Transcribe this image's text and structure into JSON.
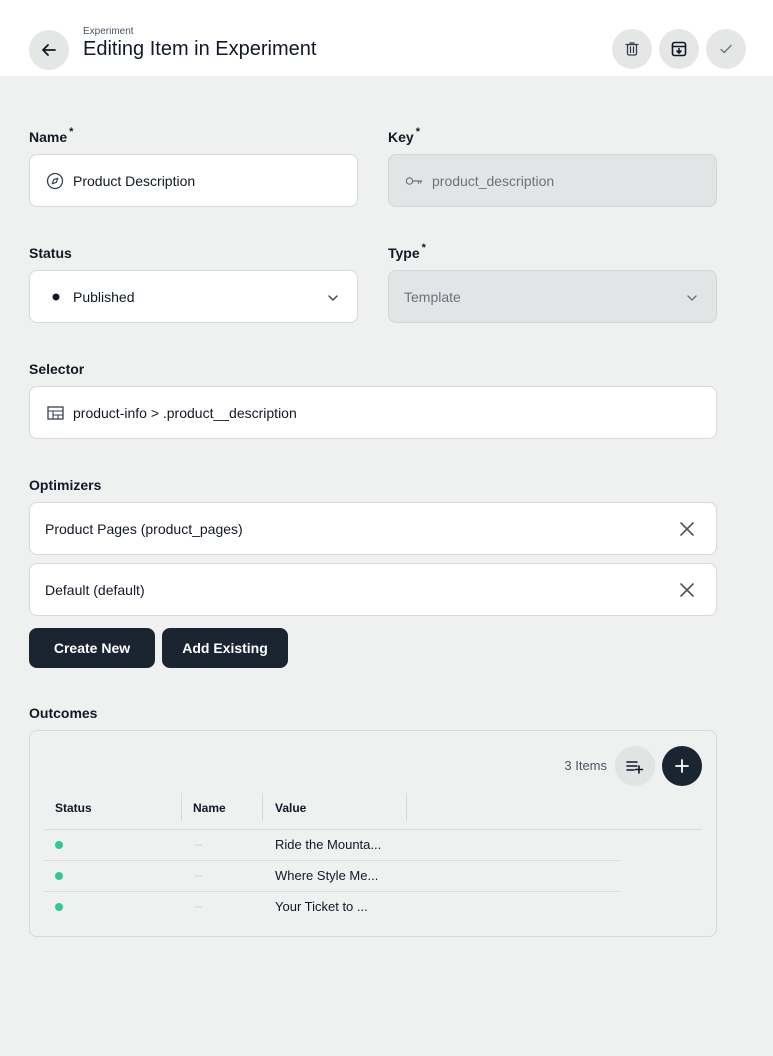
{
  "header": {
    "breadcrumb": "Experiment",
    "title": "Editing Item in Experiment",
    "icons": [
      "arrow-left-icon",
      "trash-icon",
      "archive-icon",
      "check-icon"
    ]
  },
  "form": {
    "name": {
      "label": "Name",
      "required_mark": "*",
      "value": "Product Description",
      "icon": "compass-icon"
    },
    "key": {
      "label": "Key",
      "required_mark": "*",
      "value": "product_description",
      "icon": "key-icon"
    },
    "status": {
      "label": "Status",
      "value": "Published"
    },
    "type": {
      "label": "Type",
      "required_mark": "*",
      "value": "Template"
    },
    "selector": {
      "label": "Selector",
      "value": "product-info > .product__description",
      "icon": "layout-icon"
    }
  },
  "optimizers": {
    "label": "Optimizers",
    "items": [
      "Product Pages (product_pages)",
      "Default (default)"
    ],
    "create_label": "Create New",
    "add_label": "Add Existing"
  },
  "outcomes": {
    "label": "Outcomes",
    "count_text": "3 Items",
    "columns": [
      "Status",
      "Name",
      "Value"
    ],
    "status_color": "#2ec99a",
    "rows": [
      {
        "name": "--",
        "value": "Ride the Mounta..."
      },
      {
        "name": "--",
        "value": "Where Style Me..."
      },
      {
        "name": "--",
        "value": "Your Ticket to ..."
      }
    ]
  }
}
